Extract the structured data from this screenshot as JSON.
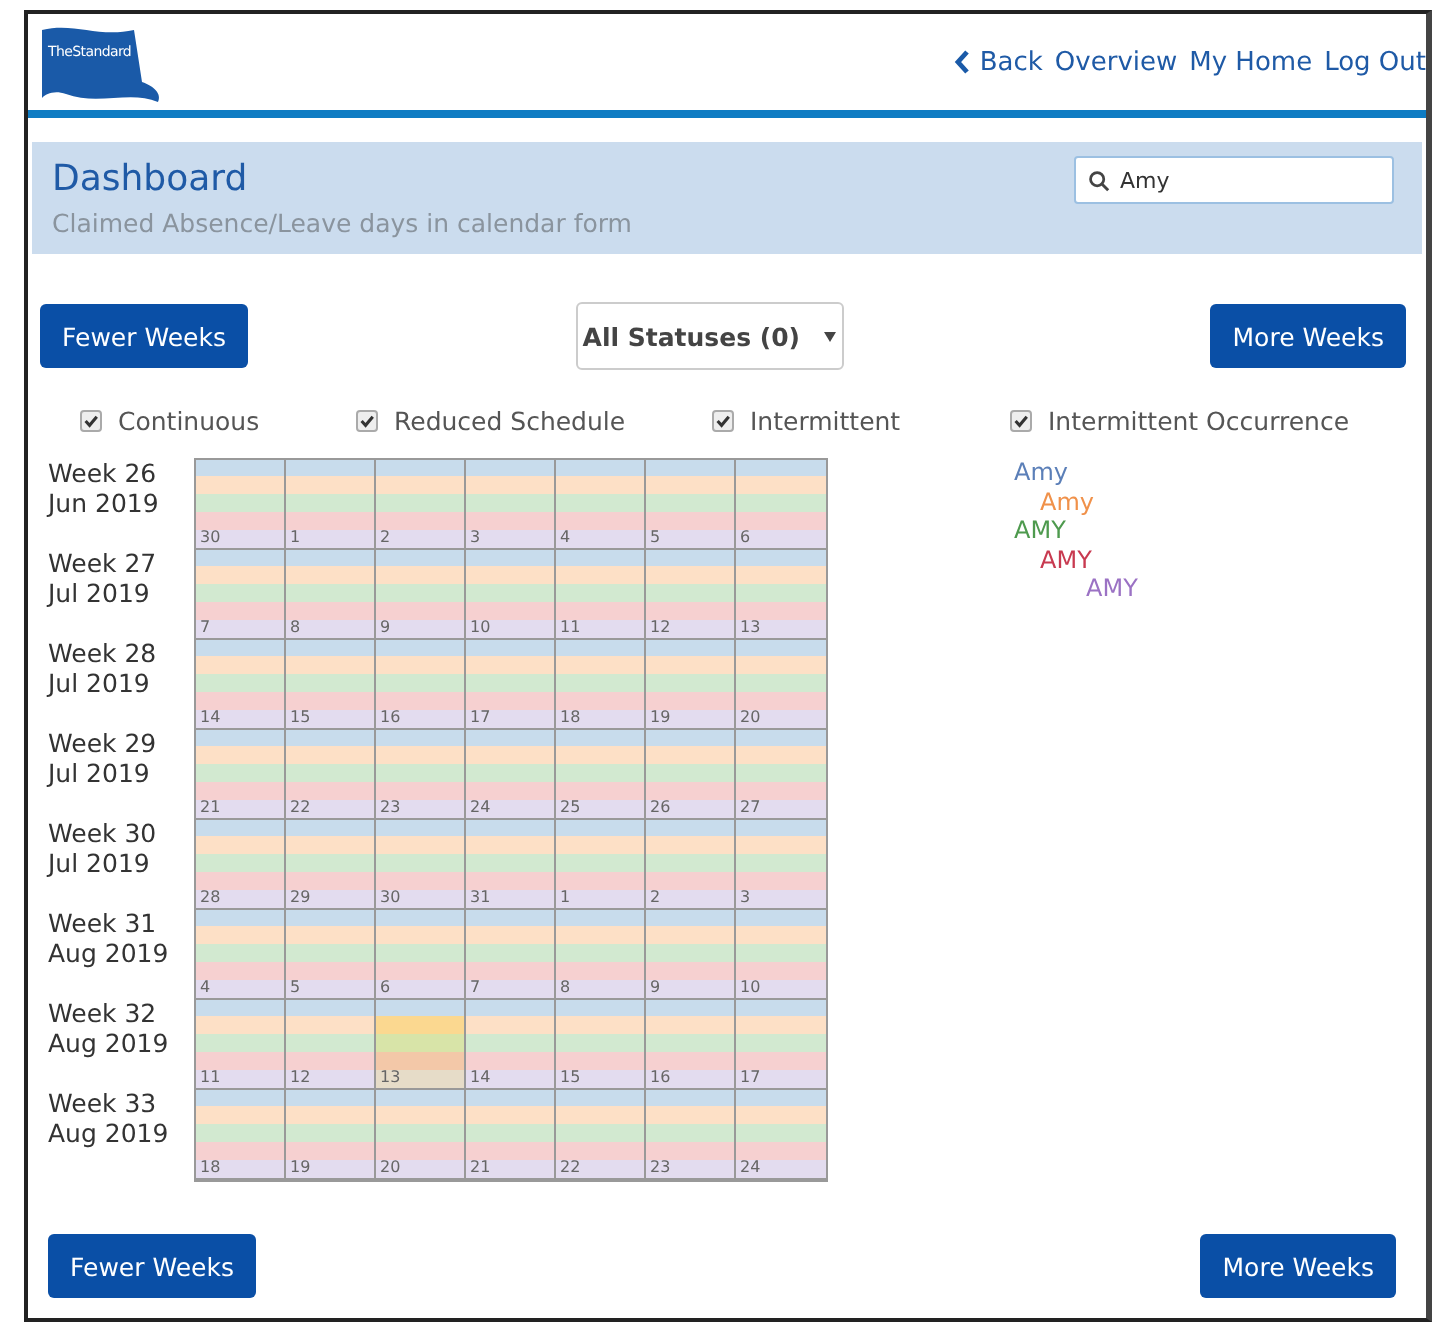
{
  "header": {
    "logo": "TheStandard",
    "nav": [
      {
        "label": "Back",
        "kind": "back"
      },
      {
        "label": "Overview",
        "kind": "link"
      },
      {
        "label": "My Home",
        "kind": "link"
      },
      {
        "label": "Log Out",
        "kind": "link"
      }
    ]
  },
  "dashboard": {
    "title": "Dashboard",
    "subtitle": "Claimed Absence/Leave days in calendar form",
    "search": {
      "value": "Amy"
    }
  },
  "controls": {
    "fewer": "Fewer Weeks",
    "status_select": "All Statuses (0)",
    "more": "More Weeks"
  },
  "filters": [
    {
      "label": "Continuous",
      "checked": true
    },
    {
      "label": "Reduced Schedule",
      "checked": true
    },
    {
      "label": "Intermittent",
      "checked": true
    },
    {
      "label": "Intermittent Occurrence",
      "checked": true
    }
  ],
  "weeks": [
    {
      "label": "Week 26",
      "month": "Jun 2019",
      "days": [
        {
          "day": "30",
          "highlighted": false
        },
        {
          "day": "1",
          "highlighted": false
        },
        {
          "day": "2",
          "highlighted": false
        },
        {
          "day": "3",
          "highlighted": false
        },
        {
          "day": "4",
          "highlighted": false
        },
        {
          "day": "5",
          "highlighted": false
        },
        {
          "day": "6",
          "highlighted": false
        }
      ]
    },
    {
      "label": "Week 27",
      "month": "Jul 2019",
      "days": [
        {
          "day": "7",
          "highlighted": false
        },
        {
          "day": "8",
          "highlighted": false
        },
        {
          "day": "9",
          "highlighted": false
        },
        {
          "day": "10",
          "highlighted": false
        },
        {
          "day": "11",
          "highlighted": false
        },
        {
          "day": "12",
          "highlighted": false
        },
        {
          "day": "13",
          "highlighted": false
        }
      ]
    },
    {
      "label": "Week 28",
      "month": "Jul 2019",
      "days": [
        {
          "day": "14",
          "highlighted": false
        },
        {
          "day": "15",
          "highlighted": false
        },
        {
          "day": "16",
          "highlighted": false
        },
        {
          "day": "17",
          "highlighted": false
        },
        {
          "day": "18",
          "highlighted": false
        },
        {
          "day": "19",
          "highlighted": false
        },
        {
          "day": "20",
          "highlighted": false
        }
      ]
    },
    {
      "label": "Week 29",
      "month": "Jul 2019",
      "days": [
        {
          "day": "21",
          "highlighted": false
        },
        {
          "day": "22",
          "highlighted": false
        },
        {
          "day": "23",
          "highlighted": false
        },
        {
          "day": "24",
          "highlighted": false
        },
        {
          "day": "25",
          "highlighted": false
        },
        {
          "day": "26",
          "highlighted": false
        },
        {
          "day": "27",
          "highlighted": false
        }
      ]
    },
    {
      "label": "Week 30",
      "month": "Jul 2019",
      "days": [
        {
          "day": "28",
          "highlighted": false
        },
        {
          "day": "29",
          "highlighted": false
        },
        {
          "day": "30",
          "highlighted": false
        },
        {
          "day": "31",
          "highlighted": false
        },
        {
          "day": "1",
          "highlighted": false
        },
        {
          "day": "2",
          "highlighted": false
        },
        {
          "day": "3",
          "highlighted": false
        }
      ]
    },
    {
      "label": "Week 31",
      "month": "Aug 2019",
      "days": [
        {
          "day": "4",
          "highlighted": false
        },
        {
          "day": "5",
          "highlighted": false
        },
        {
          "day": "6",
          "highlighted": false
        },
        {
          "day": "7",
          "highlighted": false
        },
        {
          "day": "8",
          "highlighted": false
        },
        {
          "day": "9",
          "highlighted": false
        },
        {
          "day": "10",
          "highlighted": false
        }
      ]
    },
    {
      "label": "Week 32",
      "month": "Aug 2019",
      "days": [
        {
          "day": "11",
          "highlighted": false
        },
        {
          "day": "12",
          "highlighted": false
        },
        {
          "day": "13",
          "highlighted": true
        },
        {
          "day": "14",
          "highlighted": false
        },
        {
          "day": "15",
          "highlighted": false
        },
        {
          "day": "16",
          "highlighted": false
        },
        {
          "day": "17",
          "highlighted": false
        }
      ]
    },
    {
      "label": "Week 33",
      "month": "Aug 2019",
      "days": [
        {
          "day": "18",
          "highlighted": false
        },
        {
          "day": "19",
          "highlighted": false
        },
        {
          "day": "20",
          "highlighted": false
        },
        {
          "day": "21",
          "highlighted": false
        },
        {
          "day": "22",
          "highlighted": false
        },
        {
          "day": "23",
          "highlighted": false
        },
        {
          "day": "24",
          "highlighted": false
        }
      ]
    }
  ],
  "legend": [
    {
      "name": "Amy",
      "color": "#5b7fb8",
      "children": [
        {
          "name": "Amy",
          "color": "#f0914a"
        }
      ]
    },
    {
      "name": "AMY",
      "color": "#4e9a4e",
      "children": [
        {
          "name": "AMY",
          "color": "#c83a50",
          "children": [
            {
              "name": "AMY",
              "color": "#9b72c4"
            }
          ]
        }
      ]
    }
  ],
  "footer": {
    "fewer": "Fewer Weeks",
    "more": "More Weeks"
  }
}
